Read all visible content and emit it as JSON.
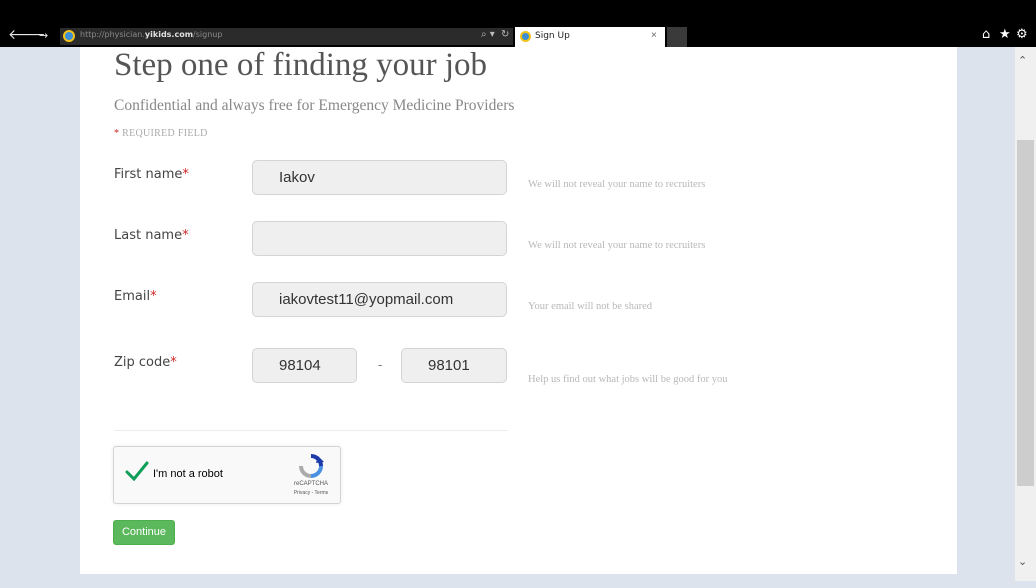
{
  "browser": {
    "url_prefix": "http://physician.",
    "url_domain": "yikids.com",
    "url_path": "/signup",
    "tab_title": "Sign Up",
    "tab_close": "×"
  },
  "page": {
    "heading": "Step one of finding your job",
    "subheading": "Confidential and always free for Emergency Medicine Providers",
    "required_star": "*",
    "required_text": "REQUIRED FIELD"
  },
  "form": {
    "first_name": {
      "label": "First name",
      "value": "Iakov",
      "hint": "We will not reveal your name to recruiters"
    },
    "last_name": {
      "label": "Last name",
      "value": "",
      "hint": "We will not reveal your name to recruiters"
    },
    "email": {
      "label": "Email",
      "value": "iakovtest11@yopmail.com",
      "hint": "Your email will not be shared"
    },
    "zip": {
      "label": "Zip code",
      "value1": "98104",
      "separator": "-",
      "value2": "98101",
      "hint": "Help us find out what jobs will be good for you"
    },
    "required_marker": "*"
  },
  "captcha": {
    "label": "I'm not a robot",
    "brand": "reCAPTCHA",
    "links": "Privacy - Terms",
    "checked": true
  },
  "actions": {
    "continue_label": "Continue"
  },
  "colors": {
    "accent_green": "#5cb85c",
    "required_red": "#d02424",
    "check_green": "#0f9d58"
  }
}
